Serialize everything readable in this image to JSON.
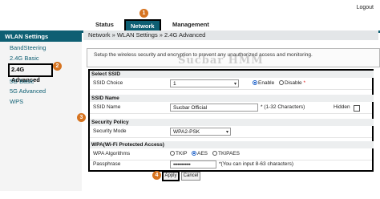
{
  "header": {
    "logout": "Logout"
  },
  "topnav": {
    "tabs": [
      "Status",
      "Network",
      "Management"
    ],
    "active": "Network"
  },
  "badges": {
    "b1": "1",
    "b2": "2",
    "b3": "3",
    "b4": "4"
  },
  "sidebar": {
    "title": "WLAN Settings",
    "items": [
      "BandSteering",
      "2.4G Basic",
      "2.4G Advanced",
      "5G Basic",
      "5G Advanced",
      "WPS"
    ],
    "active": "2.4G Advanced"
  },
  "breadcrumb": "Network » WLAN Settings » 2.4G Advanced",
  "description": "Setup the wireless security and encryption to prevent any unauthorized access and monitoring.",
  "watermark": "Sucbar HMM",
  "sections": {
    "select_ssid": "Select SSID",
    "ssid_name": "SSID Name",
    "security_policy": "Security Policy",
    "wpa": "WPA(Wi-Fi Protected Access)"
  },
  "fields": {
    "ssid_choice_label": "SSID Choice",
    "ssid_choice_value": "1",
    "enable_label": "Enable",
    "disable_label": "Disable",
    "required_mark": "*",
    "ssid_name_label": "SSID Name",
    "ssid_name_value": "Sucbar Official",
    "ssid_name_hint": "* (1-32 Characters)",
    "hidden_label": "Hidden",
    "security_mode_label": "Security Mode",
    "security_mode_value": "WPA2-PSK",
    "wpa_algorithms_label": "WPA Algorithms",
    "alg_tkip": "TKIP",
    "alg_aes": "AES",
    "alg_tkipaes": "TKIPAES",
    "passphrase_label": "Passphrase",
    "passphrase_value": "••••••••••••",
    "passphrase_hint": "*(You can input 8-63 characters)"
  },
  "buttons": {
    "apply": "Apply",
    "cancel": "Cancel"
  },
  "colors": {
    "accent": "#0e5f73",
    "badge": "#d6731f"
  }
}
